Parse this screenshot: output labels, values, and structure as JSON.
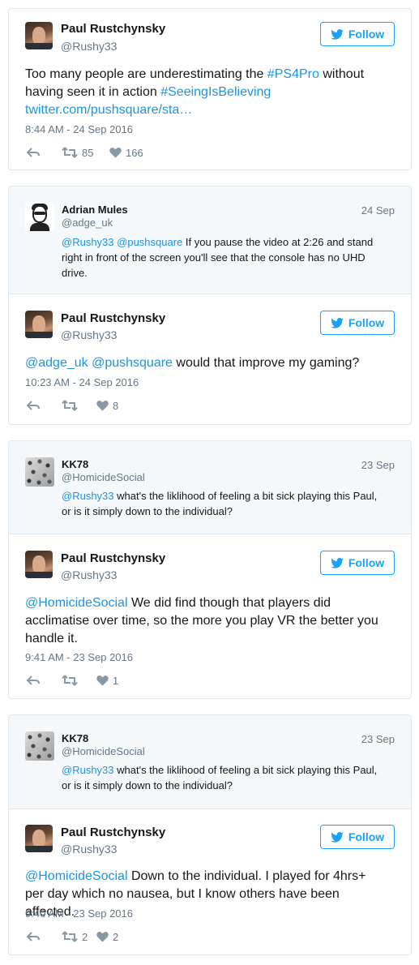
{
  "follow_label": "Follow",
  "tweet1": {
    "name": "Paul Rustchynsky",
    "handle": "@Rushy33",
    "text_plain1": "Too many people are underestimating the ",
    "tag1": "#PS4Pro",
    "text_plain2": " without having seen it in action ",
    "tag2": "#SeeingIsBelieving",
    "url": "twitter.com/pushsquare/sta…",
    "time": "8:44 AM - 24 Sep 2016",
    "retweets": "85",
    "likes": "166"
  },
  "card2": {
    "quoted": {
      "name": "Adrian Mules",
      "handle": "@adge_uk",
      "date": "24 Sep",
      "mention1": "@Rushy33",
      "mention2": "@pushsquare",
      "text": " If you pause the video at 2:26 and stand right in front of the screen you'll see that the console has no UHD drive."
    },
    "reply": {
      "name": "Paul Rustchynsky",
      "handle": "@Rushy33",
      "mention1": "@adge_uk",
      "mention2": "@pushsquare",
      "text": " would that improve my gaming?",
      "time": "10:23 AM - 24 Sep 2016",
      "likes": "8"
    }
  },
  "card3": {
    "quoted": {
      "name": "KK78",
      "handle": "@HomicideSocial",
      "date": "23 Sep",
      "mention": "@Rushy33",
      "text": " what's the liklihood of feeling a bit sick playing this Paul, or is it simply down to the individual?"
    },
    "reply": {
      "name": "Paul Rustchynsky",
      "handle": "@Rushy33",
      "mention": "@HomicideSocial",
      "text": " We did find though that players did acclimatise over time, so the more you play VR the better you handle it.",
      "time": "9:41 AM - 23 Sep 2016",
      "likes": "1"
    }
  },
  "card4": {
    "quoted": {
      "name": "KK78",
      "handle": "@HomicideSocial",
      "date": "23 Sep",
      "mention": "@Rushy33",
      "text": " what's the liklihood of feeling a bit sick playing this Paul, or is it simply down to the individual?"
    },
    "reply": {
      "name": "Paul Rustchynsky",
      "handle": "@Rushy33",
      "mention": "@HomicideSocial",
      "text": " Down to the individual. I played for 4hrs+ per day which no nausea, but I know others have been affected.",
      "time": "9:40 AM - 23 Sep 2016",
      "retweets": "2",
      "likes": "2"
    }
  },
  "colors": {
    "link": "#1b95e0",
    "follow": "#1da1f2",
    "muted": "#657786",
    "border": "#e1e8ed",
    "quote_bg": "#f5f8fa"
  },
  "icons": [
    "twitter-bird-icon",
    "reply-icon",
    "retweet-icon",
    "heart-icon"
  ]
}
